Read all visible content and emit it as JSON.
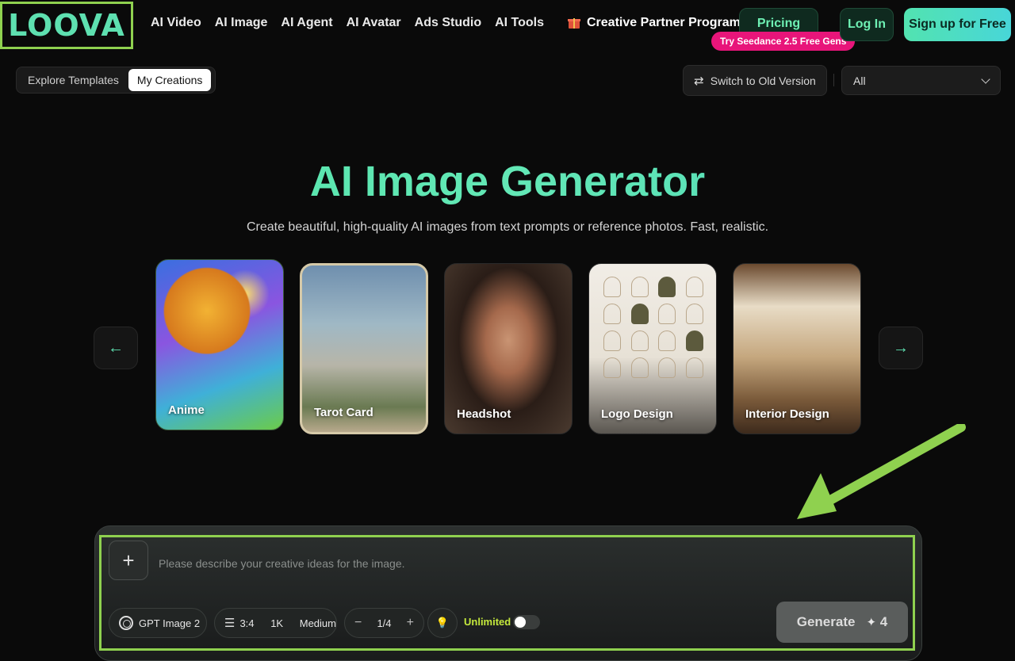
{
  "brand": {
    "logo_text": "LOOVA"
  },
  "nav": {
    "items": [
      {
        "label": "AI Video"
      },
      {
        "label": "AI Image"
      },
      {
        "label": "AI Agent"
      },
      {
        "label": "AI Avatar"
      },
      {
        "label": "Ads Studio"
      },
      {
        "label": "AI Tools"
      }
    ],
    "partner_label": "Creative Partner Program",
    "pricing_label": "Pricing",
    "promo_badge": "Try Seedance 2.5 Free Gens",
    "login_label": "Log In",
    "signup_label": "Sign up for Free"
  },
  "subbar": {
    "tabs": [
      {
        "label": "Explore Templates"
      },
      {
        "label": "My Creations"
      }
    ],
    "switch_label": "Switch to Old Version",
    "filter_value": "All"
  },
  "hero": {
    "title": "AI Image Generator",
    "subtitle": "Create beautiful, high-quality AI images from text prompts or reference photos. Fast, realistic."
  },
  "carousel": {
    "prev_label": "←",
    "next_label": "→",
    "cards": [
      {
        "label": "Anime"
      },
      {
        "label": "Tarot Card"
      },
      {
        "label": "Headshot"
      },
      {
        "label": "Logo Design"
      },
      {
        "label": "Interior Design"
      }
    ]
  },
  "prompt": {
    "placeholder": "Please describe your creative ideas for the image.",
    "model_label": "GPT Image 2",
    "ratio": "3:4",
    "resolution": "1K",
    "quality": "Medium",
    "count": "1/4",
    "unlimited_label": "Unlimited",
    "generate_label": "Generate",
    "generate_cost": "4"
  },
  "colors": {
    "accent": "#5ee0b0",
    "highlight": "#8fd14f",
    "promo": "#e8157a",
    "unlimited": "#c4e83c"
  }
}
